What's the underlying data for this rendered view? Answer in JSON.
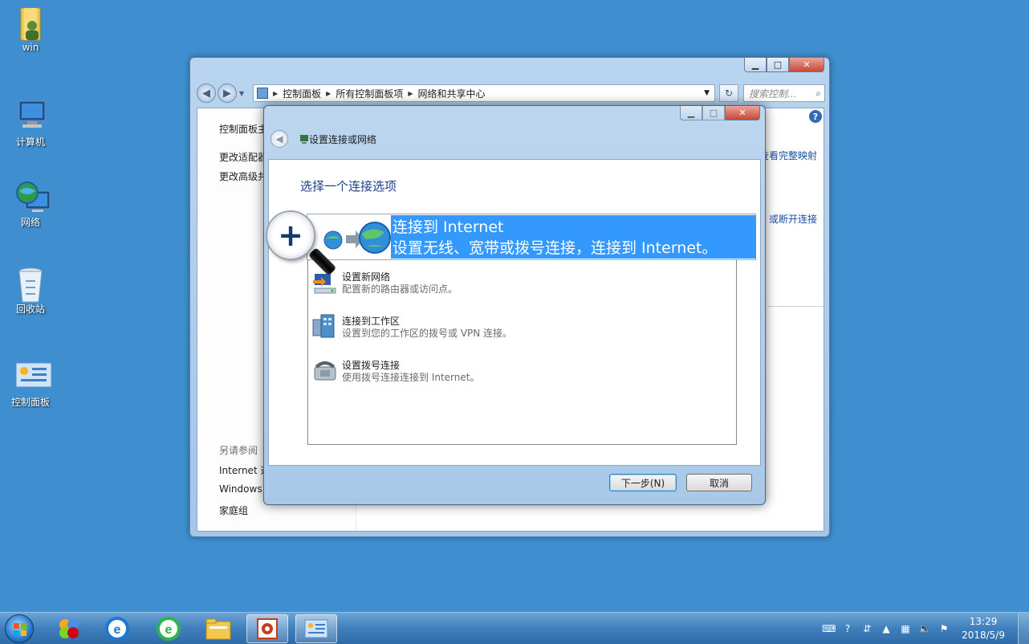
{
  "desktop": {
    "icons": [
      {
        "label": "win"
      },
      {
        "label": "计算机"
      },
      {
        "label": "网络"
      },
      {
        "label": "回收站"
      },
      {
        "label": "控制面板"
      }
    ]
  },
  "explorer": {
    "breadcrumbs": [
      "控制面板",
      "所有控制面板项",
      "网络和共享中心"
    ],
    "search_placeholder": "搜索控制...",
    "left_pane": {
      "links": [
        "控制面板主",
        "更改适配器",
        "更改高级共"
      ],
      "see_also_heading": "另请参阅",
      "see_also": [
        "Internet 选",
        "Windows",
        "家庭组"
      ]
    },
    "right_links": [
      "查看完整映射",
      "或断开连接"
    ]
  },
  "dialog": {
    "title": "设置连接或网络",
    "heading": "选择一个连接选项",
    "options": [
      {
        "title": "连接到 Internet",
        "desc": "设置无线、宽带或拨号连接，连接到 Internet。"
      },
      {
        "title": "设置新网络",
        "desc": "配置新的路由器或访问点。"
      },
      {
        "title": "连接到工作区",
        "desc": "设置到您的工作区的拨号或 VPN 连接。"
      },
      {
        "title": "设置拨号连接",
        "desc": "使用拨号连接连接到 Internet。"
      }
    ],
    "next_button": "下一步(N)",
    "cancel_button": "取消"
  },
  "taskbar": {
    "time": "13:29",
    "date": "2018/5/9"
  },
  "colors": {
    "desktop": "#3f8fd0",
    "selection": "#3399ff",
    "heading": "#1c3f8a"
  }
}
